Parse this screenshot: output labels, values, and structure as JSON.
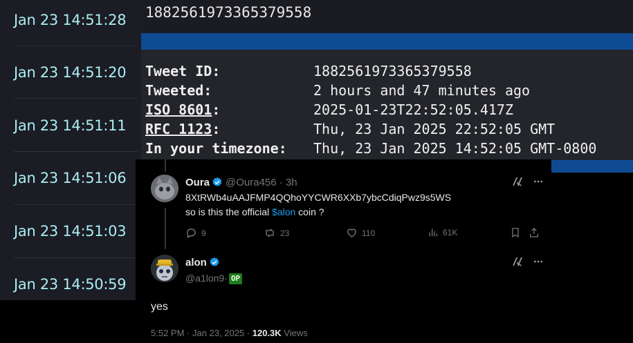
{
  "timestamps": [
    "Jan 23 14:51:28",
    "Jan 23 14:51:20",
    "Jan 23 14:51:11",
    "Jan 23 14:51:06",
    "Jan 23 14:51:03",
    "Jan 23 14:50:59"
  ],
  "id_panel": {
    "tweet_id_display": "1882561973365379558",
    "rows": [
      {
        "label": "Tweet ID:",
        "value": "1882561973365379558"
      },
      {
        "label": "Tweeted:",
        "value": "2 hours and 47 minutes ago"
      },
      {
        "label": "ISO 8601",
        "suffix": ":",
        "value": "2025-01-23T22:52:05.417Z"
      },
      {
        "label": "RFC 1123",
        "suffix": ":",
        "value": "Thu, 23 Jan 2025 22:52:05 GMT"
      },
      {
        "label": "In your timezone:",
        "value": "Thu, 23 Jan 2025 14:52:05 GMT-0800"
      }
    ]
  },
  "tweet1": {
    "name": "Oura",
    "handle": "@Oura456",
    "separator": "·",
    "age": "3h",
    "line1": "8XtRWb4uAAJFMP4QQhoYYCWR6XXb7ybcCdiqPwz9s5WS",
    "line2_pre": "so is this the official ",
    "line2_cashtag": "$alon",
    "line2_post": " coin ?",
    "replies": "9",
    "reposts": "23",
    "likes": "110",
    "views": "61K"
  },
  "tweet2": {
    "name": "alon",
    "handle": "@a1lon9",
    "handle_sep": "·",
    "badge": "OP",
    "text": "yes",
    "time": "5:52 PM",
    "dot": " · ",
    "date": "Jan 23, 2025",
    "dot2": " · ",
    "views_count": "120.3K",
    "views_label": " Views"
  }
}
